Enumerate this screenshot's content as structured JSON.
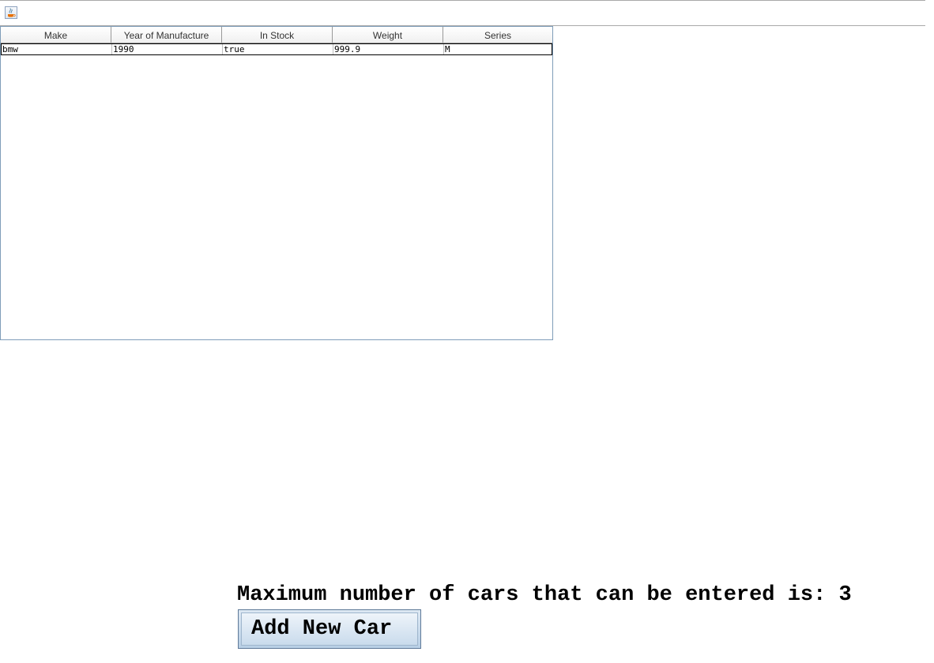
{
  "toolbar": {
    "icon": "java-cup-icon"
  },
  "table": {
    "columns": [
      "Make",
      "Year of Manufacture",
      "In Stock",
      "Weight",
      "Series"
    ],
    "rows": [
      [
        "bmw",
        "1990",
        "true",
        "999.9",
        "M"
      ]
    ]
  },
  "footer": {
    "max_label": "Maximum number of cars that can be entered is: 3",
    "add_button_label": "Add New Car"
  }
}
